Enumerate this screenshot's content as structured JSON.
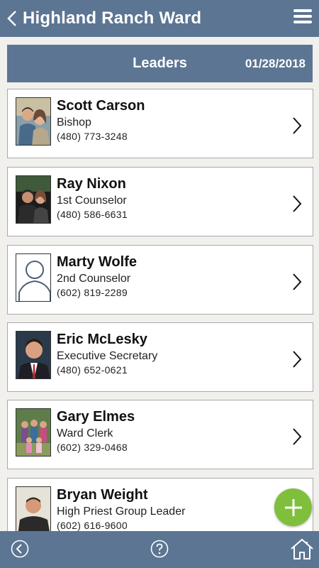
{
  "app": {
    "title": "Highland Ranch Ward"
  },
  "section": {
    "title": "Leaders",
    "date": "01/28/2018"
  },
  "leaders": [
    {
      "name": "Scott Carson",
      "role": "Bishop",
      "phone": "(480) 773-3248",
      "photo": "couple-photo"
    },
    {
      "name": "Ray Nixon",
      "role": "1st Counselor",
      "phone": "(480) 586-6631",
      "photo": "couple-photo"
    },
    {
      "name": "Marty Wolfe",
      "role": "2nd Counselor",
      "phone": "(602) 819-2289",
      "photo": "placeholder-person-icon"
    },
    {
      "name": "Eric McLesky",
      "role": "Executive Secretary",
      "phone": "(480) 652-0621",
      "photo": "portrait-photo"
    },
    {
      "name": "Gary Elmes",
      "role": "Ward Clerk",
      "phone": "(602) 329-0468",
      "photo": "family-photo"
    },
    {
      "name": "Bryan Weight",
      "role": "High Priest Group Leader",
      "phone": "(602) 616-9600",
      "photo": "portrait-photo"
    }
  ],
  "nav": {
    "icons": [
      "back-circle-icon",
      "help-icon",
      "home-icon"
    ]
  },
  "colors": {
    "header": "#5c7593",
    "fab": "#7fbf3c",
    "background": "#f1f0ec"
  }
}
